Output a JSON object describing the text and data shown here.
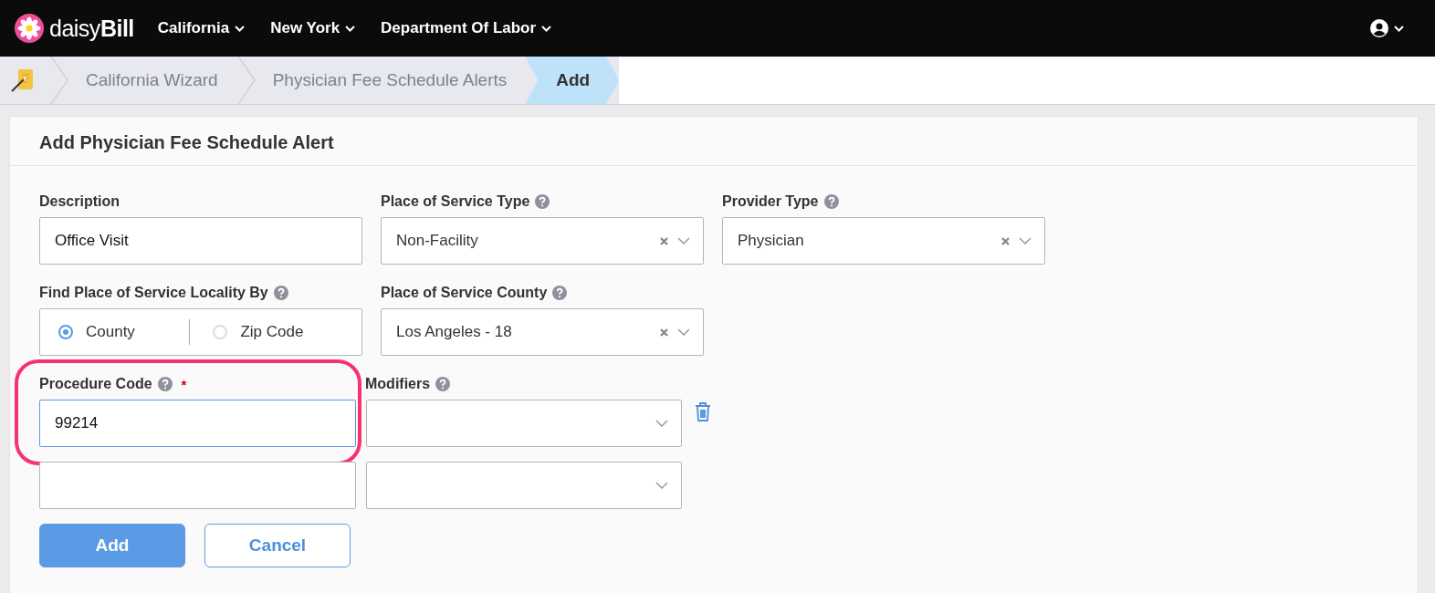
{
  "nav": {
    "logo": "daisy**Bill**",
    "menus": [
      {
        "label": "California"
      },
      {
        "label": "New York"
      },
      {
        "label": "Department Of Labor"
      }
    ]
  },
  "breadcrumb": [
    {
      "label": "California Wizard",
      "selected": false
    },
    {
      "label": "Physician Fee Schedule Alerts",
      "selected": false
    },
    {
      "label": "Add",
      "selected": true
    }
  ],
  "form": {
    "title": "Add Physician Fee Schedule Alert",
    "rows": [
      [
        {
          "kind": "text",
          "label": "Description",
          "help": false,
          "value": "Office Visit"
        },
        {
          "kind": "select",
          "label": "Place of Service Type",
          "help": true,
          "value": "Non-Facility"
        },
        {
          "kind": "select",
          "label": "Provider Type",
          "help": true,
          "value": "Physician"
        }
      ],
      [
        {
          "kind": "radio",
          "label": "Find Place of Service Locality By",
          "help": true,
          "options": [
            {
              "label": "County",
              "selected": true
            },
            {
              "label": "Zip Code",
              "selected": false
            }
          ]
        },
        {
          "kind": "select",
          "label": "Place of Service County",
          "help": true,
          "value": "Los Angeles - 18"
        }
      ]
    ],
    "procedure_label": "Procedure Code",
    "procedure_help": true,
    "required_mark": "*",
    "modifiers_label": "Modifiers",
    "modifiers_help": true,
    "procedure_rows": [
      {
        "code": "99214",
        "focused": true,
        "highlighted": true,
        "deletable": true
      },
      {
        "code": "",
        "focused": false,
        "highlighted": false,
        "deletable": false
      }
    ],
    "buttons": [
      {
        "kind": "primary",
        "label": "Add"
      },
      {
        "kind": "secondary",
        "label": "Cancel"
      }
    ]
  }
}
